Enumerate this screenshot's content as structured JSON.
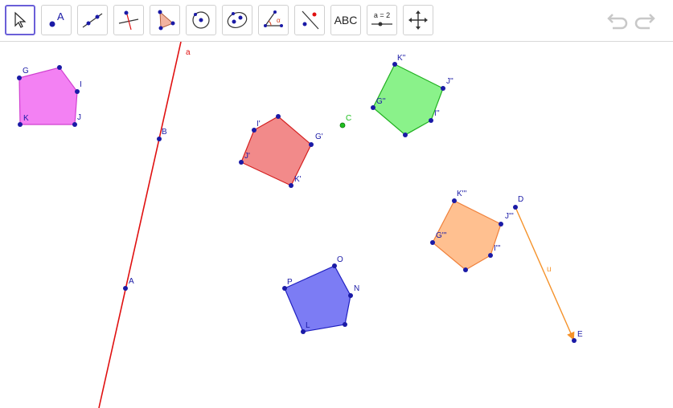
{
  "toolbar": {
    "tools": [
      {
        "id": "move",
        "icon": "arrow-cursor-icon"
      },
      {
        "id": "point",
        "icon": "point-icon",
        "label": "A"
      },
      {
        "id": "line",
        "icon": "line-through-points-icon"
      },
      {
        "id": "perpendicular",
        "icon": "perpendicular-line-icon"
      },
      {
        "id": "polygon",
        "icon": "polygon-icon"
      },
      {
        "id": "circle",
        "icon": "circle-center-point-icon"
      },
      {
        "id": "ellipse",
        "icon": "ellipse-icon"
      },
      {
        "id": "angle",
        "icon": "angle-icon"
      },
      {
        "id": "reflect",
        "icon": "reflect-about-line-icon"
      },
      {
        "id": "text",
        "icon": "text-icon",
        "label": "ABC"
      },
      {
        "id": "slider",
        "icon": "slider-icon",
        "label": "a = 2"
      },
      {
        "id": "move-view",
        "icon": "move-graphics-view-icon"
      }
    ],
    "undo_icon": "undo-icon",
    "redo_icon": "redo-icon"
  },
  "colors": {
    "point": "#1a1aa6",
    "line_a": "#e01010",
    "vector_u": "#f5922a",
    "poly_pink_fill": "#f27af2",
    "poly_pink_stroke": "#d040d0",
    "poly_red_fill": "#f28a8a",
    "poly_red_stroke": "#d42020",
    "poly_green_fill": "#8af28a",
    "poly_green_stroke": "#20b020",
    "poly_orange_fill": "#ffc090",
    "poly_orange_stroke": "#f0803a",
    "poly_blue_fill": "#7c7cf4",
    "poly_blue_stroke": "#2020c0",
    "point_c": "#20c020"
  },
  "labels": {
    "line_a": "a",
    "vector_u": "u",
    "A": "A",
    "B": "B",
    "C": "C",
    "D": "D",
    "E": "E",
    "G": "G",
    "I": "I",
    "J": "J",
    "K": "K",
    "G1": "G'",
    "I1": "I'",
    "J1": "J'",
    "K1": "K'",
    "G2": "G''",
    "I2": "I''",
    "J2": "J''",
    "K2": "K''",
    "G3": "G'''",
    "I3": "I'''",
    "J3": "J'''",
    "K3": "K'''",
    "L": "L",
    "N": "N",
    "O": "O",
    "P": "P"
  }
}
